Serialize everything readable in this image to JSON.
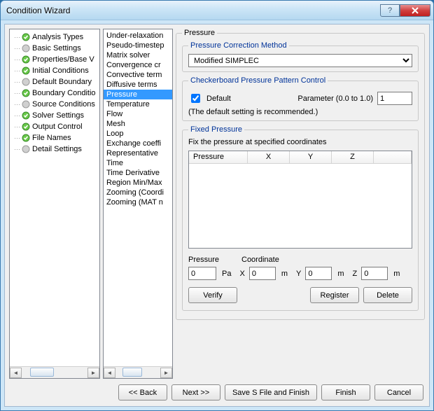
{
  "window": {
    "title": "Condition Wizard"
  },
  "tree": {
    "items": [
      {
        "label": "Analysis Types",
        "icon": "green"
      },
      {
        "label": "Basic Settings",
        "icon": "gray"
      },
      {
        "label": "Properties/Base V",
        "icon": "green"
      },
      {
        "label": "Initial Conditions",
        "icon": "green"
      },
      {
        "label": "Default Boundary",
        "icon": "gray"
      },
      {
        "label": "Boundary Conditio",
        "icon": "green"
      },
      {
        "label": "Source Conditions",
        "icon": "gray"
      },
      {
        "label": "Solver Settings",
        "icon": "green"
      },
      {
        "label": "Output Control",
        "icon": "green"
      },
      {
        "label": "File Names",
        "icon": "green"
      },
      {
        "label": "Detail Settings",
        "icon": "gray"
      }
    ]
  },
  "list": {
    "items": [
      "Under-relaxation",
      "Pseudo-timestep",
      "Matrix solver",
      "Convergence cr",
      "Convective term",
      "Diffusive terms",
      "Pressure",
      "Temperature",
      "Flow",
      "Mesh",
      "Loop",
      "Exchange coeffi",
      "Representative",
      "Time",
      "Time Derivative",
      "Region Min/Max",
      "Zooming (Coordi",
      "Zooming (MAT n"
    ],
    "selected_index": 6
  },
  "pressure": {
    "group_title": "Pressure",
    "correction": {
      "group_title": "Pressure Correction Method",
      "value": "Modified SIMPLEC"
    },
    "checker": {
      "group_title": "Checkerboard Pressure Pattern Control",
      "default_label": "Default",
      "default_checked": true,
      "param_label": "Parameter  (0.0 to 1.0)",
      "param_value": "1",
      "note": "(The default setting is recommended.)"
    },
    "fixed": {
      "group_title": "Fixed Pressure",
      "desc": "Fix the pressure at specified coordinates",
      "columns": [
        "Pressure",
        "X",
        "Y",
        "Z"
      ],
      "pressure_label": "Pressure",
      "coordinate_label": "Coordinate",
      "pressure_value": "0",
      "pressure_unit": "Pa",
      "x_value": "0",
      "y_value": "0",
      "z_value": "0",
      "coord_unit": "m",
      "buttons": {
        "verify": "Verify",
        "register": "Register",
        "delete": "Delete"
      }
    }
  },
  "buttons": {
    "back": "<< Back",
    "next": "Next >>",
    "save": "Save S File and Finish",
    "finish": "Finish",
    "cancel": "Cancel"
  }
}
